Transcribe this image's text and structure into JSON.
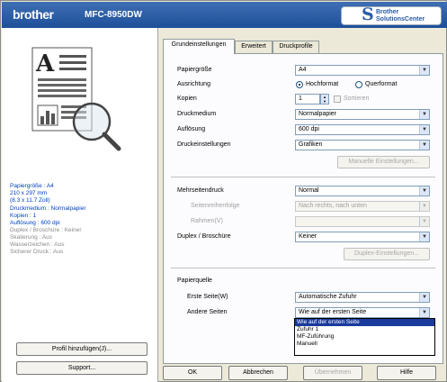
{
  "header": {
    "brand": "brother",
    "model": "MFC-8950DW",
    "solutions_center_1": "Brother",
    "solutions_center_2": "SolutionsCenter"
  },
  "sidebar": {
    "info": [
      {
        "text": "Papiergröße : A4",
        "style": "blue"
      },
      {
        "text": "210 x 297 mm",
        "style": "blue"
      },
      {
        "text": "(8.3 x 11.7 Zoll)",
        "style": "blue"
      },
      {
        "text": "Druckmedium : Normalpapier",
        "style": "blue"
      },
      {
        "text": "Kopien : 1",
        "style": "blue"
      },
      {
        "text": "Auflösung : 600 dpi",
        "style": "blue"
      },
      {
        "text": "Duplex / Broschüre : Keiner",
        "style": "gray"
      },
      {
        "text": "Skalierung : Aus",
        "style": "gray"
      },
      {
        "text": "Wasserzeichen : Aus",
        "style": "gray"
      },
      {
        "text": "Sicherer Druck : Aus",
        "style": "gray"
      }
    ],
    "profile_button": "Profil hinzufügen(J)...",
    "support_button": "Support..."
  },
  "tabs": [
    "Grundeinstellungen",
    "Erweitert",
    "Druckprofile"
  ],
  "form": {
    "paper_size_label": "Papiergröße",
    "paper_size_value": "A4",
    "orientation_label": "Ausrichtung",
    "orientation_portrait": "Hochformat",
    "orientation_landscape": "Querformat",
    "copies_label": "Kopien",
    "copies_value": "1",
    "sort_label": "Sortieren",
    "media_label": "Druckmedium",
    "media_value": "Normalpapier",
    "resolution_label": "Auflösung",
    "resolution_value": "600 dpi",
    "print_settings_label": "Druckeinstellungen",
    "print_settings_value": "Grafiken",
    "manual_settings_button": "Manuelle Einstellungen...",
    "multipage_label": "Mehrseitendruck",
    "multipage_value": "Normal",
    "page_order_label": "Seitenreihenfolge",
    "page_order_value": "Nach rechts, nach unten",
    "border_label": "Rahmen(V)",
    "border_value": "",
    "duplex_label": "Duplex / Broschüre",
    "duplex_value": "Keiner",
    "duplex_settings_button": "Duplex-Einstellungen...",
    "paper_source_label": "Papierquelle",
    "first_page_label": "Erste Seite(W)",
    "first_page_value": "Automatische Zufuhr",
    "other_pages_label": "Andere Seiten",
    "other_pages_value": "Wie auf der ersten Seite",
    "other_pages_options": [
      "Wie auf der ersten Seite",
      "Zufuhr 1",
      "MF-Zuführung",
      "Manuell"
    ]
  },
  "footer": {
    "ok": "OK",
    "cancel": "Abbrechen",
    "apply": "Übernehmen",
    "help": "Hilfe"
  },
  "colors": {
    "header": "#1d4f99",
    "highlight": "#1a3a9c",
    "info_blue": "#0040c0"
  }
}
